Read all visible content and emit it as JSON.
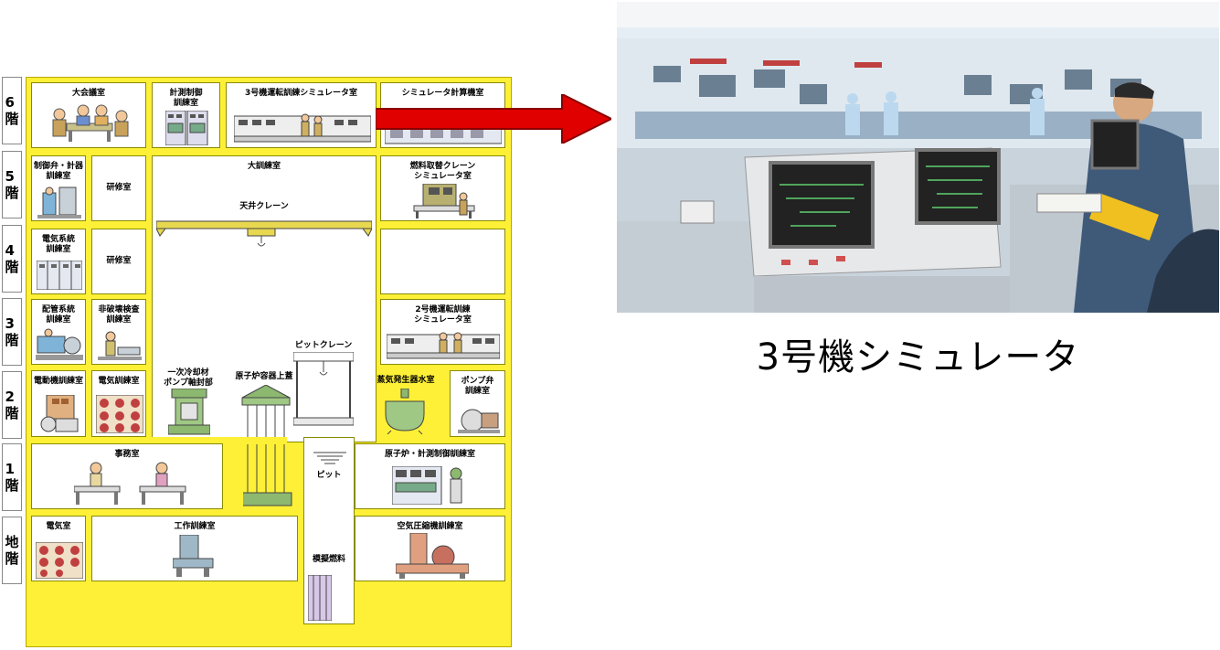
{
  "floors": [
    "6\n階",
    "5\n階",
    "4\n階",
    "3\n階",
    "2\n階",
    "1\n階",
    "地\n階"
  ],
  "rooms": {
    "r6_1": "大会議室",
    "r6_2": "計測制御\n訓練室",
    "r6_3": "3号機運転訓練シミュレータ室",
    "r6_4": "シミュレータ計算機室",
    "r5_1": "制御弁・計器\n訓練室",
    "r5_2": "研修室",
    "r5_big": "大訓練室",
    "r5_crane": "天井クレーン",
    "r5_4": "燃料取替クレーン\nシミュレータ室",
    "r4_1": "電気系統\n訓練室",
    "r4_2": "研修室",
    "r3_1": "配管系統\n訓練室",
    "r3_2": "非破壊検査\n訓練室",
    "r3_4": "2号機運転訓練\nシミュレータ室",
    "pit_crane": "ピットクレーン",
    "r2_1": "電動機訓練室",
    "r2_2": "電気訓練室",
    "r2_pump": "一次冷却材\nポンプ軸封部",
    "r2_vessel": "原子炉容器上蓋",
    "r2_steam": "蒸気発生器水室",
    "r2_pumpvalve": "ポンプ弁\n訓練室",
    "pit": "ピット",
    "r1_office": "事務室",
    "r1_reactor": "原子炉・計測制御訓練室",
    "b_elec": "電気室",
    "b_work": "工作訓練室",
    "b_fuel": "模擬燃料",
    "b_air": "空気圧縮機訓練室"
  },
  "caption": "3号機シミュレータ",
  "colors": {
    "building": "#fdf036",
    "arrow": "#e00000"
  }
}
